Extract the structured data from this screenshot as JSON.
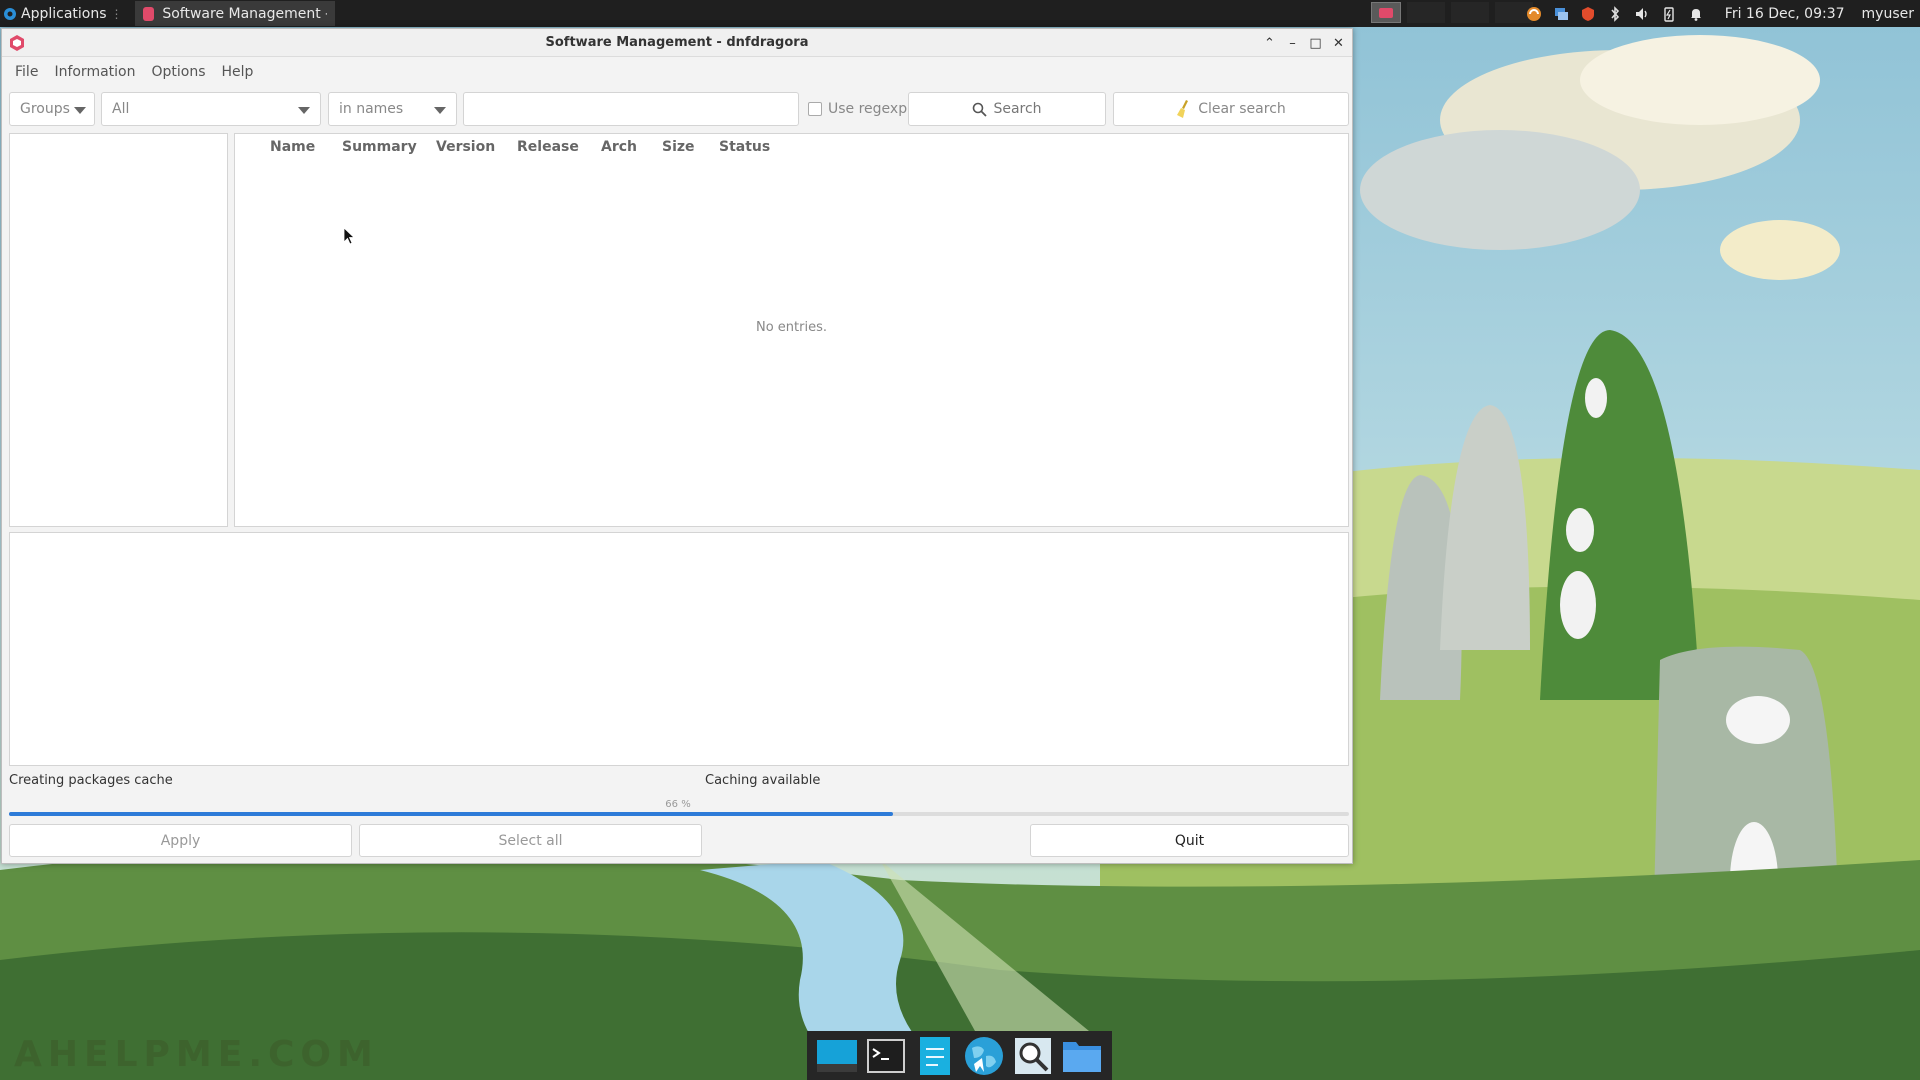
{
  "panel": {
    "applications_label": "Applications",
    "taskbar_window_title": "Software Management - d...",
    "datetime": "Fri 16 Dec, 09:37",
    "username": "myuser"
  },
  "window": {
    "title": "Software Management - dnfdragora"
  },
  "menu": {
    "items": [
      "File",
      "Information",
      "Options",
      "Help"
    ]
  },
  "toolbar": {
    "groups_label": "Groups",
    "filter_value": "All",
    "scope_value": "in names",
    "search_value": "",
    "regexp_label": "Use regexp",
    "regexp_checked": false,
    "search_label": "Search",
    "clear_label": "Clear search"
  },
  "table": {
    "columns": [
      "Name",
      "Summary",
      "Version",
      "Release",
      "Arch",
      "Size",
      "Status"
    ],
    "empty_text": "No entries."
  },
  "status": {
    "left_text": "Creating packages cache",
    "right_text": "Caching available",
    "progress_percent": 66,
    "progress_text": "66 %"
  },
  "buttons": {
    "apply_label": "Apply",
    "select_all_label": "Select all",
    "quit_label": "Quit"
  },
  "watermark": "AHELPME.COM",
  "colors": {
    "accent": "#2d7bd8",
    "app_icon": "#e04a6a"
  }
}
